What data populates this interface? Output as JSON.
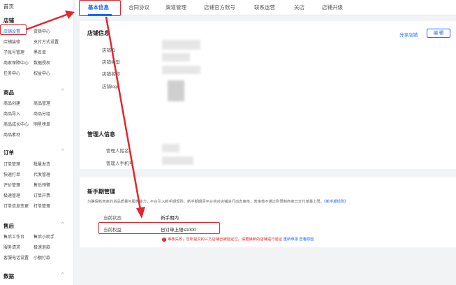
{
  "sidebar": {
    "home": "首页",
    "sections": [
      {
        "title": "店铺",
        "items": [
          "店铺设置",
          "资质中心",
          "店铺装修",
          "支付方式设置",
          "子账号管理",
          "黑名单",
          "商家保障中心",
          "数据授权",
          "任务中心",
          "权益中心"
        ]
      },
      {
        "title": "商品",
        "items": [
          "商品创建",
          "商品管理",
          "商品导入",
          "商品分组",
          "商品成长中心",
          "明星榜单",
          "商品素材"
        ]
      },
      {
        "title": "订单",
        "items": [
          "订单管理",
          "批量发货",
          "快速打单",
          "代发管理",
          "评价管理",
          "售后预警",
          "极速管理",
          "订单开票",
          "订单信息变更",
          "打单管理"
        ]
      },
      {
        "title": "售后",
        "items": [
          "售后工作台",
          "售后小助手",
          "服务请求",
          "极速退款",
          "客服电话设置",
          "小额打款"
        ]
      },
      {
        "title": "数据",
        "items": [
          "",
          ""
        ]
      }
    ],
    "active_item": "店铺设置",
    "caret": "^"
  },
  "tabs": [
    "基本信息",
    "合同协议",
    "渠道管理",
    "店铺官方账号",
    "联系运营",
    "关店",
    "店铺升级"
  ],
  "shop_info": {
    "title": "店铺信息",
    "share_label": "分享店铺",
    "edit_label": "编 辑",
    "fields": [
      "店铺ID",
      "店铺类型",
      "店铺名称",
      "店铺logo"
    ]
  },
  "admin_info": {
    "title": "管理人信息",
    "fields": [
      "管理人姓名",
      "管理人手机号"
    ]
  },
  "newbie": {
    "title": "新手期管理",
    "desc_prefix": "为确保新商家的货品质量与服务能力，平台引入新手期规则，新手期期间平台将对店铺进行动态审核，若审核不通过则限制商家日支付单量上限。",
    "desc_link": "《新手期规则》",
    "status_label": "当前状态",
    "status_value": "新手期内",
    "benefit_label": "当前权益",
    "benefit_value": "日订单上限≤1000",
    "error_icon": "!",
    "error_text": "审核失败，您所提交的三方店铺已被验证过，请更换新的店铺进行验证",
    "retry_link": "重新申报",
    "rule_link": "查看原因"
  },
  "annotation": {
    "color": "#e0282e"
  }
}
